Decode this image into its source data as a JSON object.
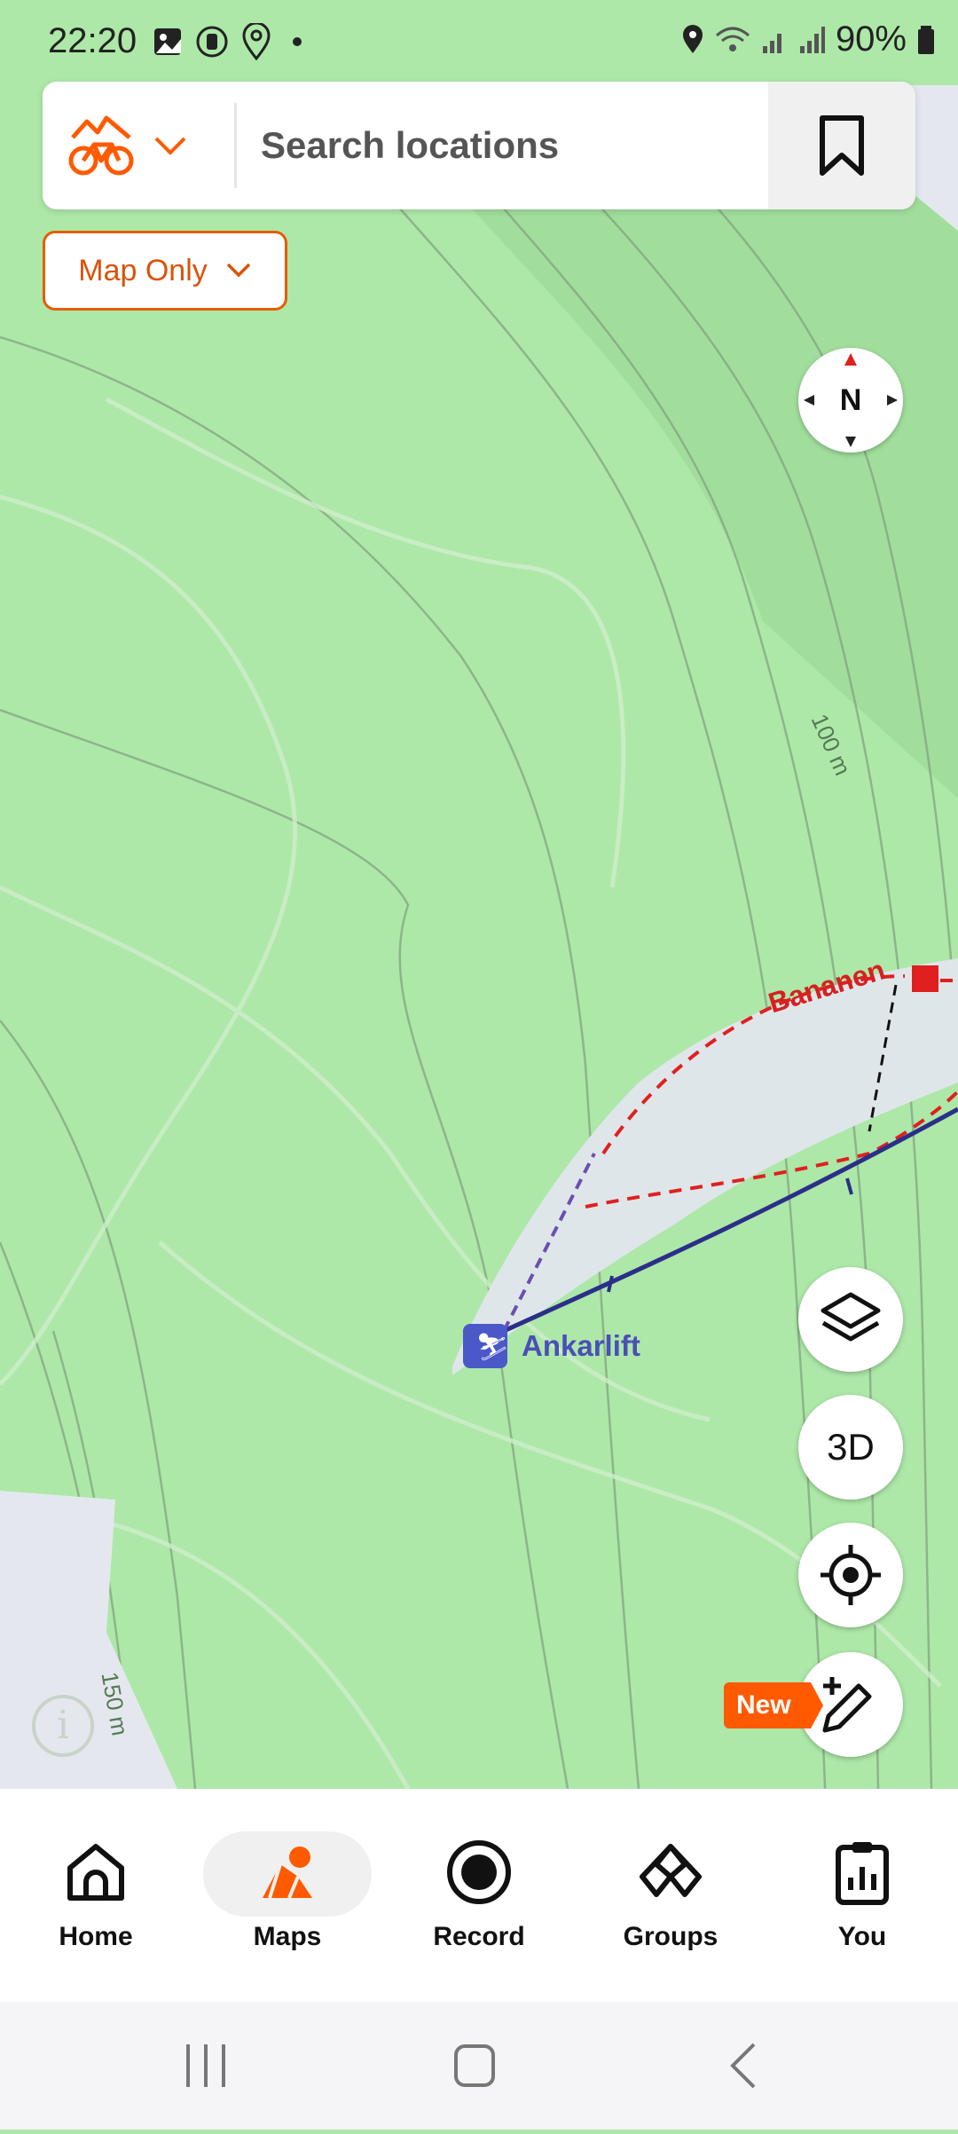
{
  "status_bar": {
    "time": "22:20",
    "battery": "90%"
  },
  "search": {
    "placeholder": "Search locations"
  },
  "map_filter": {
    "label": "Map Only"
  },
  "compass": {
    "label": "N"
  },
  "map_labels": {
    "contour_100": "100 m",
    "contour_150": "150 m",
    "lift_name": "Ankarlift",
    "piste_name": "Bananen"
  },
  "fab": {
    "three_d": "3D",
    "new_badge": "New"
  },
  "bottom_nav": [
    {
      "label": "Home"
    },
    {
      "label": "Maps"
    },
    {
      "label": "Record"
    },
    {
      "label": "Groups"
    },
    {
      "label": "You"
    }
  ],
  "colors": {
    "accent": "#ff5a00",
    "map_green": "#ade8a8",
    "lift_blue": "#2b2f8a",
    "piste_red": "#e02020"
  }
}
